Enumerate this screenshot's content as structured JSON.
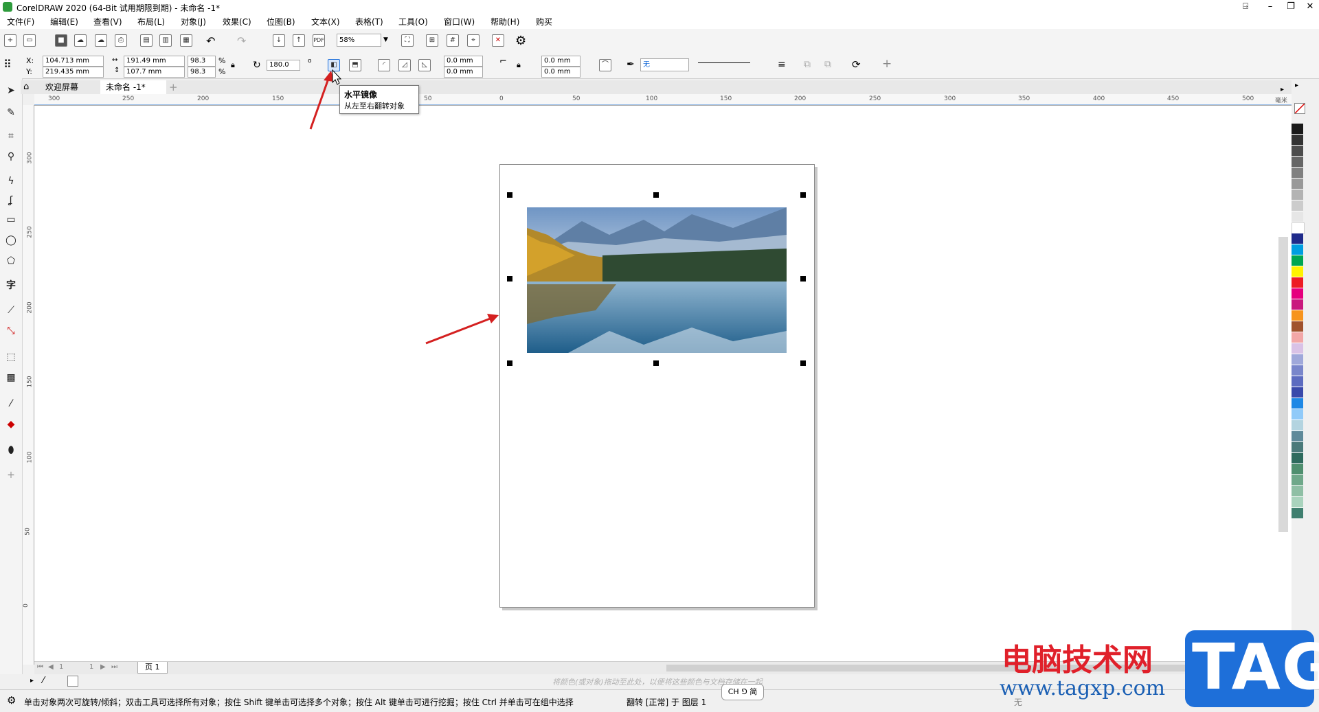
{
  "window": {
    "title": "CorelDRAW 2020 (64-Bit 试用期限到期) - 未命名 -1*"
  },
  "menu": [
    "文件(F)",
    "编辑(E)",
    "查看(V)",
    "布局(L)",
    "对象(J)",
    "效果(C)",
    "位图(B)",
    "文本(X)",
    "表格(T)",
    "工具(O)",
    "窗口(W)",
    "帮助(H)",
    "购买"
  ],
  "toolbar": {
    "zoom": "58%"
  },
  "properties": {
    "x_label": "X:",
    "x_value": "104.713 mm",
    "y_label": "Y:",
    "y_value": "219.435 mm",
    "width": "191.49 mm",
    "height": "107.7 mm",
    "scale_x": "98.3",
    "scale_y": "98.3",
    "percent": "%",
    "rotation": "180.0",
    "degree": "o",
    "corner_1": "0.0 mm",
    "corner_2": "0.0 mm",
    "corner_3": "0.0 mm",
    "corner_4": "0.0 mm",
    "fill_value": "无"
  },
  "tabs": {
    "welcome": "欢迎屏幕",
    "document": "未命名 -1*",
    "add": "+"
  },
  "tooltip": {
    "title": "水平镜像",
    "description": "从左至右翻转对象"
  },
  "ruler": {
    "h_ticks": [
      "300",
      "250",
      "200",
      "150",
      "100",
      "50",
      "0",
      "50",
      "100",
      "150",
      "200",
      "250",
      "300",
      "350",
      "400",
      "450",
      "500"
    ],
    "unit": "毫米",
    "v_ticks": [
      "300",
      "250",
      "200",
      "150",
      "100",
      "50",
      "0"
    ]
  },
  "pages": {
    "page_tab": "页 1",
    "count_a": "1",
    "count_b": "1"
  },
  "doc_palette_hint": "将颜色(或对象)拖动至此处，以便将这些颜色与文档存储在一起",
  "status": {
    "hint": "单击对象两次可旋转/倾斜；双击工具可选择所有对象；按住 Shift 键单击可选择多个对象；按住 Alt 键单击可进行挖掘；按住 Ctrl 并单击可在组中选择",
    "object": "翻转 [正常] 于 图层 1",
    "ime": "CH ⅁ 简",
    "fill": "无"
  },
  "watermark": {
    "cn": "电脑技术网",
    "url": "www.tagxp.com",
    "logo": "TAG"
  },
  "colors": {
    "accent": "#1e6fd9",
    "arrow": "#d42020",
    "brand_red": "#e0202a"
  }
}
